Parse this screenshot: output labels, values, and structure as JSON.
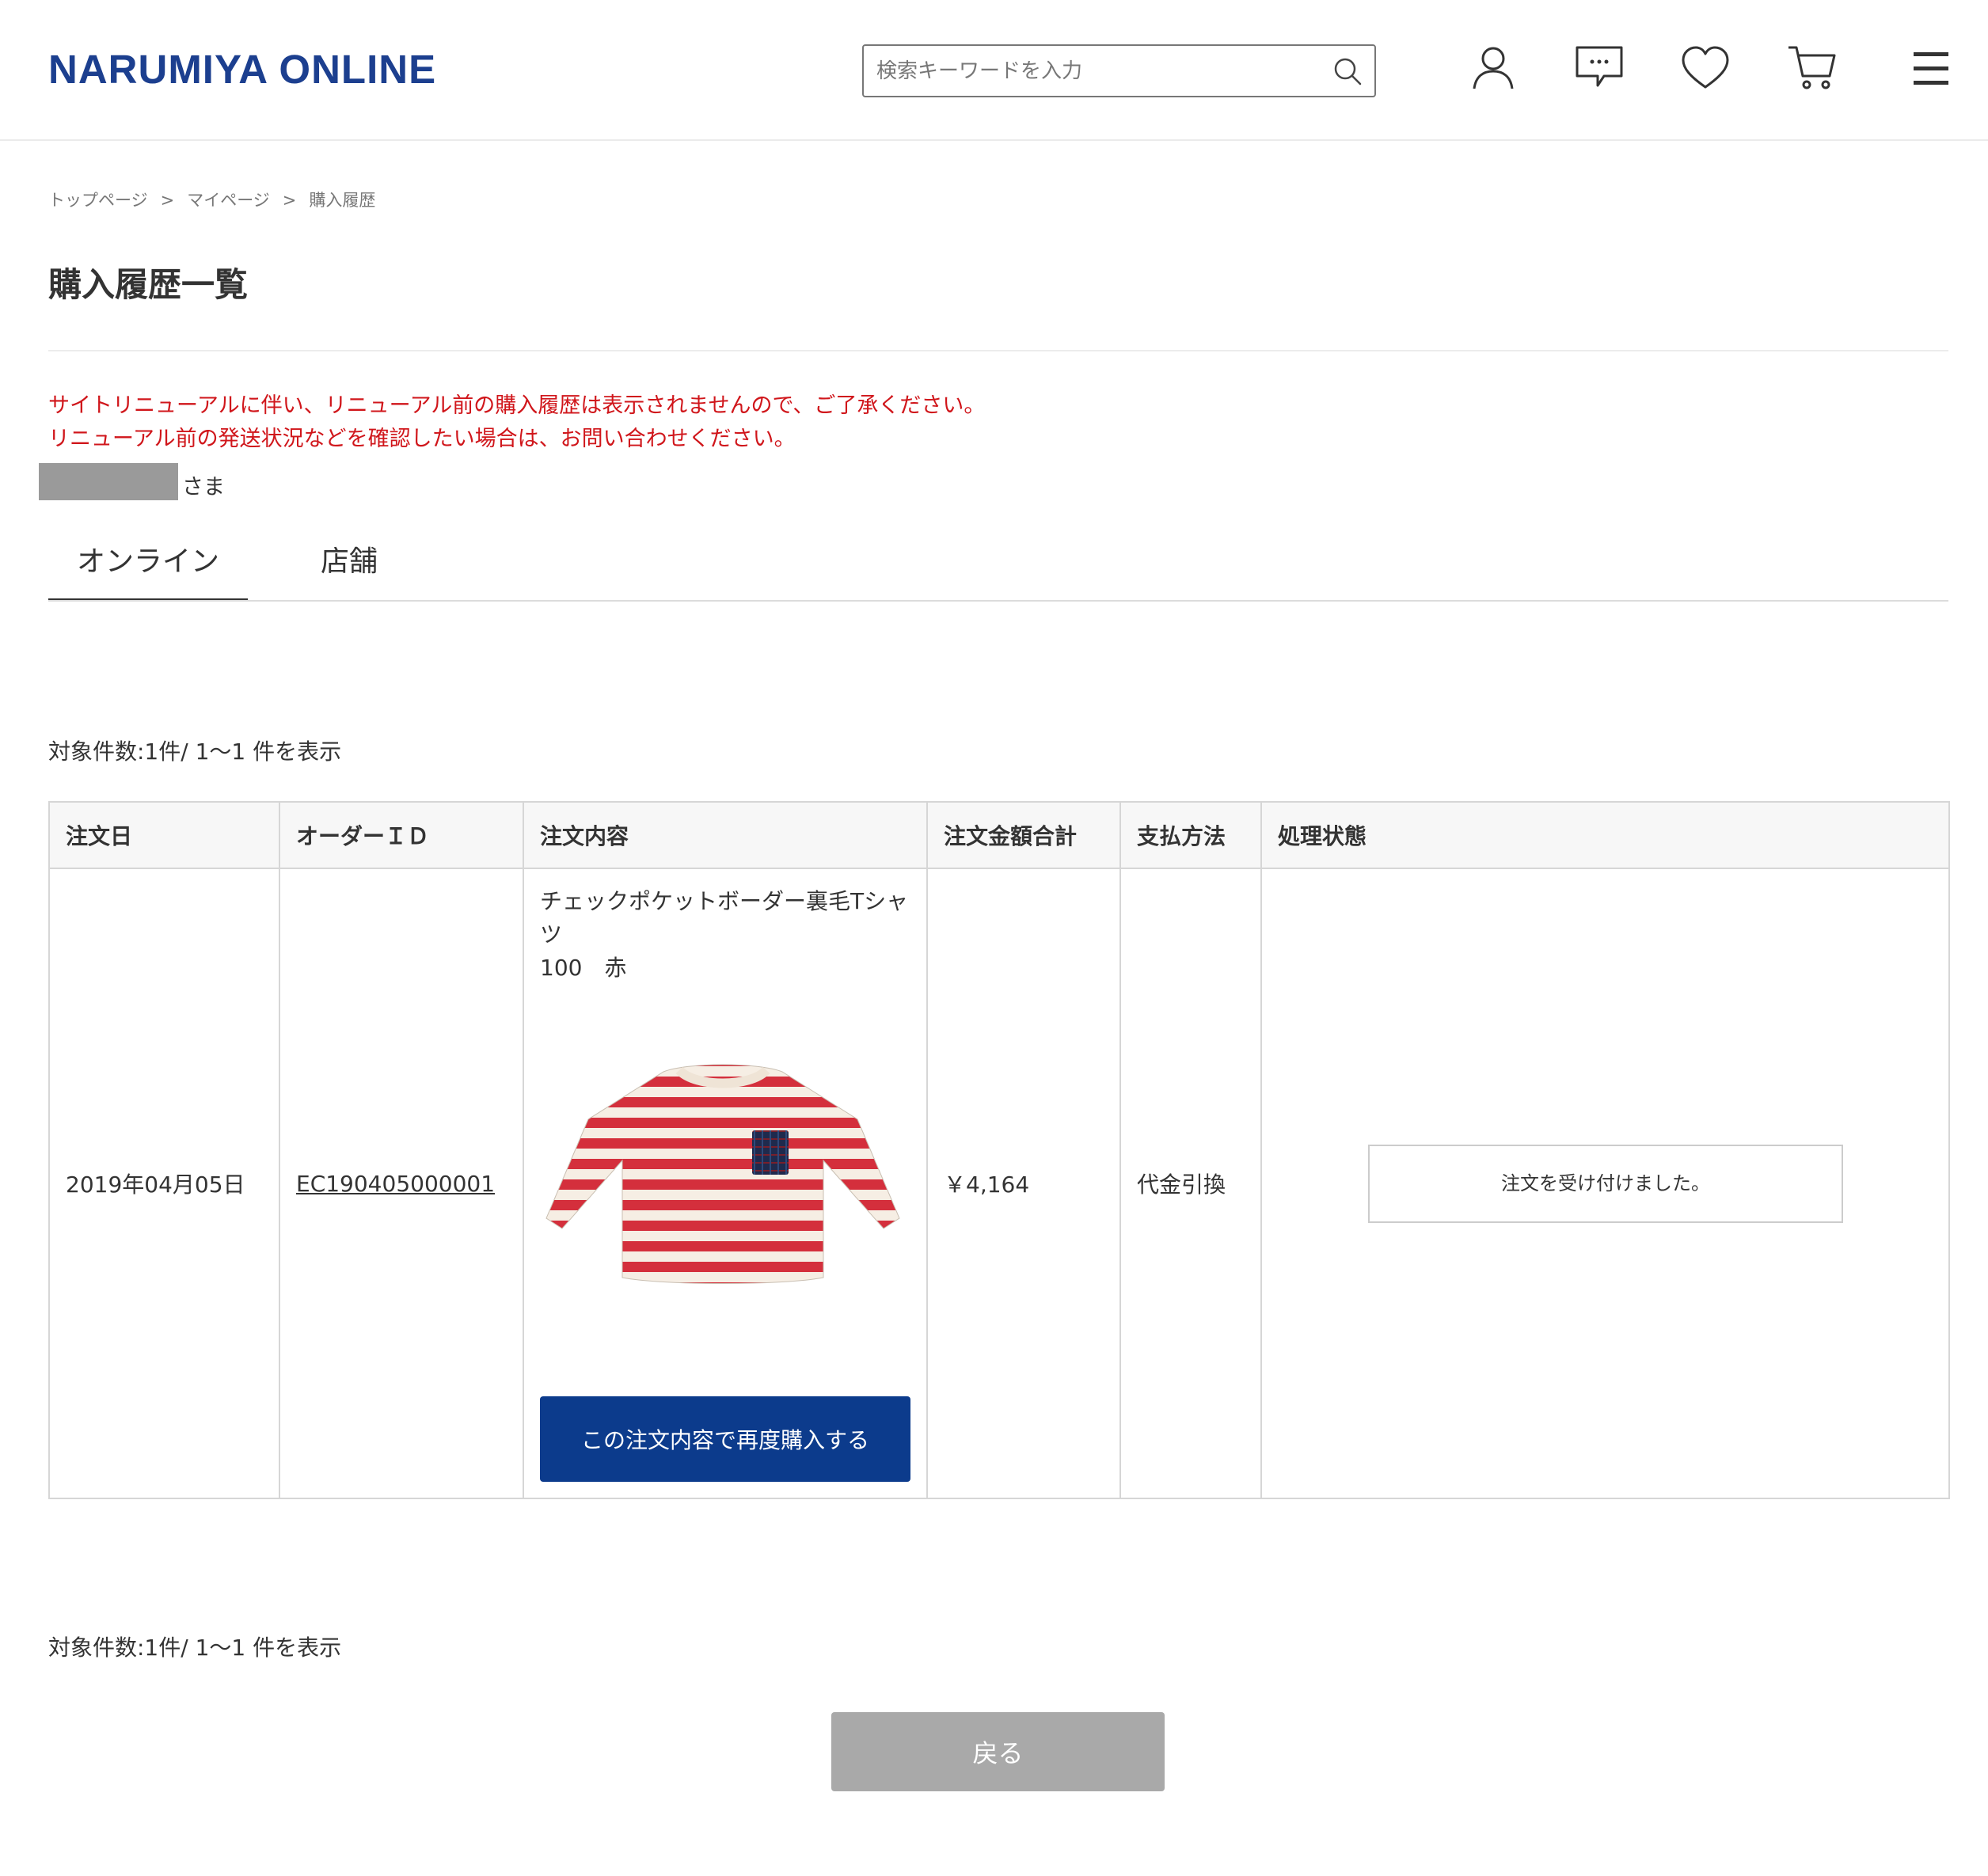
{
  "header": {
    "logo": "NARUMIYA ONLINE",
    "search_placeholder": "検索キーワードを入力",
    "icons": [
      "search-icon",
      "user-icon",
      "chat-icon",
      "heart-icon",
      "cart-icon",
      "menu-icon"
    ]
  },
  "breadcrumb": [
    "トップページ",
    "マイページ",
    "購入履歴"
  ],
  "breadcrumb_separator": ">",
  "page_title": "購入履歴一覧",
  "notice": {
    "line1": "サイトリニューアルに伴い、リニューアル前の購入履歴は表示されませんので、ご了承ください。",
    "line2": "リニューアル前の発送状況などを確認したい場合は、お問い合わせください。"
  },
  "user_suffix": "さま",
  "tabs": [
    {
      "label": "オンライン",
      "active": true
    },
    {
      "label": "店舗",
      "active": false
    }
  ],
  "count_text": "対象件数:1件/ 1〜1 件を表示",
  "table": {
    "headers": [
      "注文日",
      "オーダーＩＤ",
      "注文内容",
      "注文金額合計",
      "支払方法",
      "処理状態"
    ],
    "rows": [
      {
        "date": "2019年04月05日",
        "order_id": "EC190405000001",
        "product_name": "チェックポケットボーダー裏毛Tシャツ",
        "product_variant": "100　赤",
        "rebuy_label": "この注文内容で再度購入する",
        "total": "￥4,164",
        "payment": "代金引換",
        "status": "注文を受け付けました。"
      }
    ]
  },
  "back_label": "戻る",
  "colors": {
    "brand": "#1c3f8f",
    "notice_red": "#d0161b",
    "primary_button": "#0c3b8c",
    "back_button": "#a9a9a9",
    "stripe_red": "#d42f3c",
    "stripe_cream": "#f6eee4",
    "pocket_navy": "#1f2a4d"
  }
}
